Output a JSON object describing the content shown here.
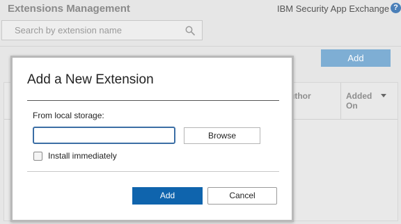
{
  "page": {
    "title": "Extensions Management",
    "app_exchange_link": "IBM Security App Exchange",
    "help_icon": "question-icon",
    "help_label": "?"
  },
  "search": {
    "placeholder": "Search by extension name",
    "value": "",
    "icon": "search-icon"
  },
  "toolbar": {
    "add_label": "Add"
  },
  "table": {
    "columns": [
      {
        "label": "Author"
      },
      {
        "label": "Added On",
        "sort_icon": "chevron-down-icon"
      }
    ],
    "visible_columns": {
      "author_partial": "uthor",
      "added_on": "Added On"
    }
  },
  "modal": {
    "title": "Add a New Extension",
    "local_storage_label": "From local storage:",
    "file_value": "",
    "browse_label": "Browse",
    "install_immediately_label": "Install immediately",
    "install_immediately_checked": false,
    "add_label": "Add",
    "cancel_label": "Cancel"
  },
  "colors": {
    "accent": "#0f64ad",
    "accent_disabled": "#7eaed4",
    "focus_border": "#3b6ea5",
    "help_icon": "#4a7fb8",
    "background": "#e6e6e6"
  }
}
